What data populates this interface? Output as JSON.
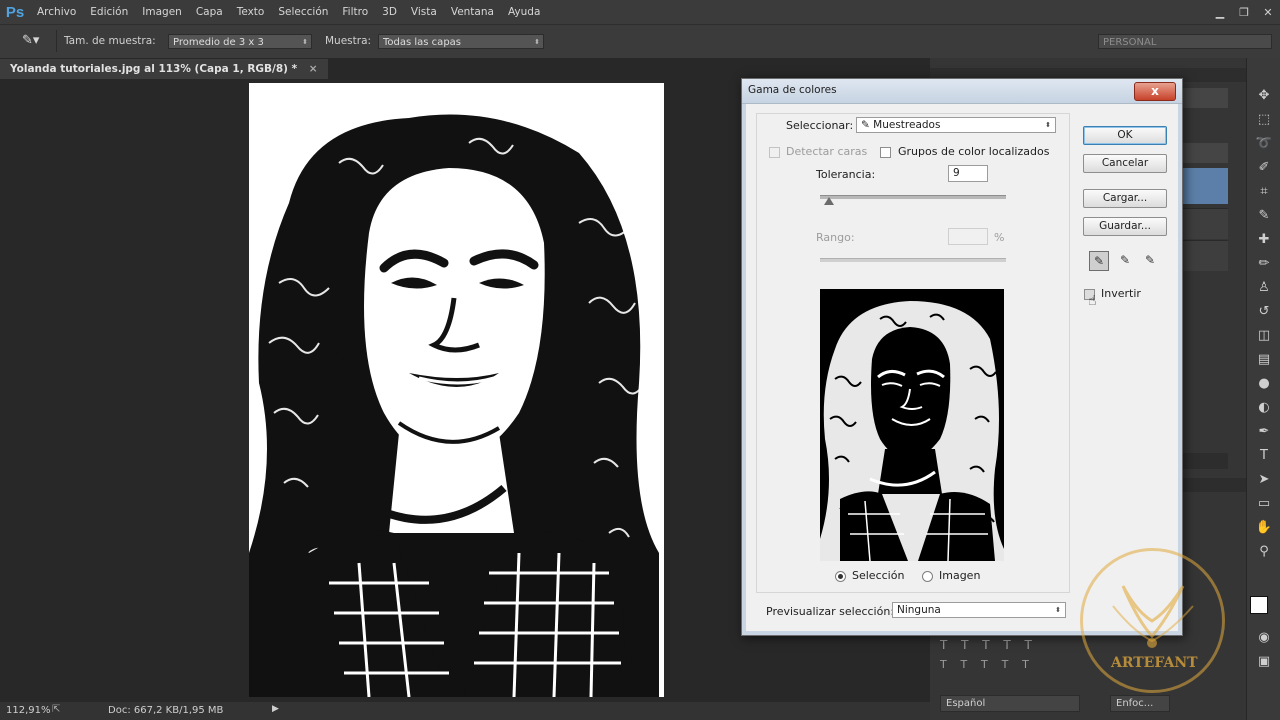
{
  "menubar": {
    "logo": "Ps",
    "items": [
      "Archivo",
      "Edición",
      "Imagen",
      "Capa",
      "Texto",
      "Selección",
      "Filtro",
      "3D",
      "Vista",
      "Ventana",
      "Ayuda"
    ]
  },
  "options": {
    "sample_size_label": "Tam. de muestra:",
    "sample_size_value": "Promedio de 3 x 3",
    "sample_label": "Muestra:",
    "sample_value": "Todas las capas",
    "workspace": "PERSONAL"
  },
  "document": {
    "tab_title": "Yolanda tutoriales.jpg al 113% (Capa 1, RGB/8) *",
    "tab_close": "×"
  },
  "status": {
    "zoom": "112,91%",
    "doc_info": "Doc: 667,2 KB/1,95 MB"
  },
  "panels": {
    "language": "Español",
    "antialias": "Enfoc..."
  },
  "dialog": {
    "title": "Gama de colores",
    "close_label": "x",
    "select_label": "Seleccionar:",
    "select_value": "Muestreados",
    "detect_faces_label": "Detectar caras",
    "localized_label": "Grupos de color localizados",
    "tolerance_label": "Tolerancia:",
    "tolerance_value": "9",
    "tolerance_fraction": 0.05,
    "range_label": "Rango:",
    "range_unit": "%",
    "buttons": {
      "ok": "OK",
      "cancel": "Cancelar",
      "load": "Cargar...",
      "save": "Guardar..."
    },
    "invert_label": "Invertir",
    "radio_selection": "Selección",
    "radio_image": "Imagen",
    "preview_label": "Previsualizar selección:",
    "preview_value": "Ninguna"
  },
  "watermark": {
    "text": "ARTEFANT"
  },
  "colors": {
    "menubar": "#3b3b3b",
    "workspace": "#282828",
    "dialog_bg": "#f0f0f0",
    "close_red": "#c7422a",
    "accent_blue": "#3c7fb1",
    "watermark_gold": "#e2aa3c"
  }
}
